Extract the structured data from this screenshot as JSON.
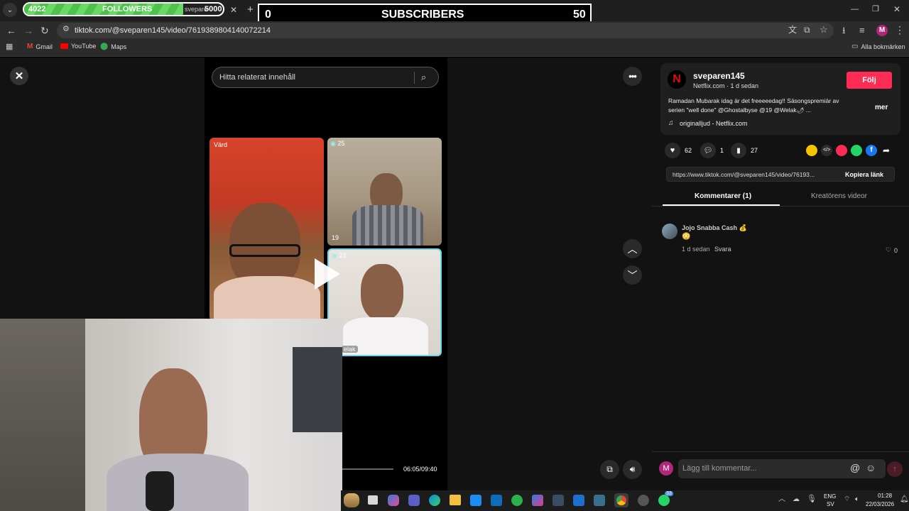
{
  "overlay": {
    "followers_count": "4022",
    "followers_label": "FOLLOWERS",
    "followers_tab": "svepare",
    "followers_goal": "5000",
    "subscribers_count": "0",
    "subscribers_label": "SUBSCRIBERS",
    "subscribers_goal": "50"
  },
  "browser": {
    "url": "tiktok.com/@sveparen145/video/7619389804140072214",
    "bookmarks": [
      "Gmail",
      "YouTube",
      "Maps"
    ],
    "all_bookmarks": "Alla bokmärken",
    "profile_initial": "M"
  },
  "video": {
    "search_placeholder": "Hitta relaterat innehåll",
    "host_label": "Värd",
    "tile2_badge": "25",
    "tile2_count": "19",
    "tile3_badge": "23",
    "tile3_name": "elak",
    "time": "06:05/09:40"
  },
  "post": {
    "username": "sveparen145",
    "subtitle": "Netflix.com · 1 d sedan",
    "follow_label": "Följ",
    "caption_line1": "Ramadan Mubarak idag är det freeeeedag!! Säsongspremiär av",
    "caption_line2": "serien \"well done\" @Ghostalbyse @19 @Welak🌶 ...",
    "more_label": "mer",
    "sound": "originalljud - Netflix.com",
    "likes": "62",
    "comments": "1",
    "saves": "27",
    "link": "https://www.tiktok.com/@sveparen145/video/76193...",
    "copy_label": "Kopiera länk",
    "tab_comments": "Kommentarer (1)",
    "tab_creator": "Kreatörens videor"
  },
  "comment": {
    "author": "Jojo Snabba Cash 💰",
    "text": "😳",
    "time": "1 d sedan",
    "reply_label": "Svara",
    "likes": "0"
  },
  "composer": {
    "avatar_initial": "M",
    "placeholder": "Lägg till kommentar..."
  },
  "taskbar": {
    "lang": "ENG",
    "region": "SV",
    "time": "01:28",
    "date": "22/03/2026",
    "whatsapp_badge": "33"
  },
  "colors": {
    "accent": "#fe2c55",
    "followers_bar": "#5fd05a",
    "tile_border": "#6fd6e8"
  }
}
